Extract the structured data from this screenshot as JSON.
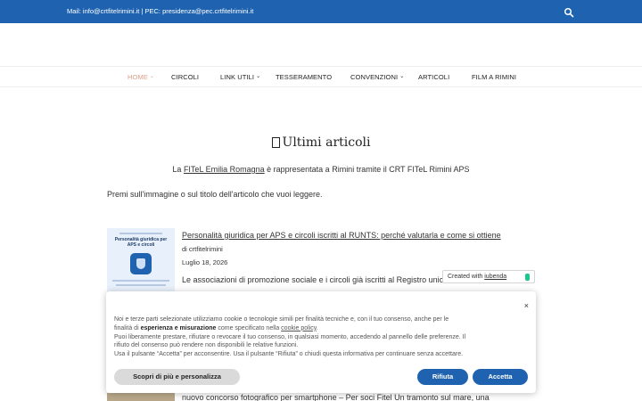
{
  "topbar": {
    "contact": "Mail: info@crtfitelrimini.it | PEC: presidenza@pec.crtfitelrimini.it",
    "search_icon": "search-icon",
    "color": "#1f63b0"
  },
  "nav": {
    "items": [
      {
        "label": "HOME",
        "has_submenu": true,
        "active": true
      },
      {
        "label": "CIRCOLI",
        "has_submenu": false
      },
      {
        "label": "LINK UTILI",
        "has_submenu": true
      },
      {
        "label": "TESSERAMENTO",
        "has_submenu": false
      },
      {
        "label": "CONVENZIONI",
        "has_submenu": true
      },
      {
        "label": "ARTICOLI",
        "has_submenu": false
      },
      {
        "label": "FILM A RIMINI",
        "has_submenu": false
      }
    ],
    "chevron": "⌄"
  },
  "main": {
    "section_icon": "document-icon",
    "section_title": "Ultimi articoli",
    "intro_prefix": "La ",
    "intro_link": "FITeL Emilia Romagna",
    "intro_suffix": " è rappresentata a Rimini tramite il CRT FITeL Rimini APS",
    "instructions": "Premi sull'immagine o sul titolo dell'articolo che vuoi leggere."
  },
  "posts": [
    {
      "thumb_title": "Personalità giuridica per APS e circoli",
      "title": "Personalità giuridica per APS e circoli iscritti al RUNTS: perché valutarla e come si ottiene",
      "author": "di crtfitelrimini",
      "date": "Luglio 18, 2026",
      "excerpt": "Le associazioni di promozione sociale e i circoli già iscritti al Registro unico"
    },
    {
      "title": "nuovo concorso fotografico per smartphone – Per soci Fitel Un tramonto sul mare, una"
    }
  ],
  "iubenda_badge": {
    "prefix": "Created with ",
    "brand": "iubenda"
  },
  "cookie_banner": {
    "close": "×",
    "line1": "Noi e terze parti selezionate utilizziamo cookie o tecnologie simili per finalità tecniche e, con il tuo consenso, anche per le",
    "line2_prefix": "finalità di ",
    "line2_bold": "esperienza e misurazione",
    "line2_mid": " come specificato nella ",
    "line2_link": "cookie policy",
    "line2_suffix": ".",
    "line3": "Puoi liberamente prestare, rifiutare o revocare il tuo consenso, in qualsiasi momento, accedendo al pannello delle preferenze. Il",
    "line4": "rifiuto del consenso può rendere non disponibili le relative funzioni.",
    "line5": "Usa il pulsante “Accetta” per acconsentire. Usa il pulsante “Rifiuta” o chiudi questa informativa per continuare senza accettare.",
    "more_button": "Scopri di più e personalizza",
    "reject_button": "Rifiuta",
    "accept_button": "Accetta"
  }
}
